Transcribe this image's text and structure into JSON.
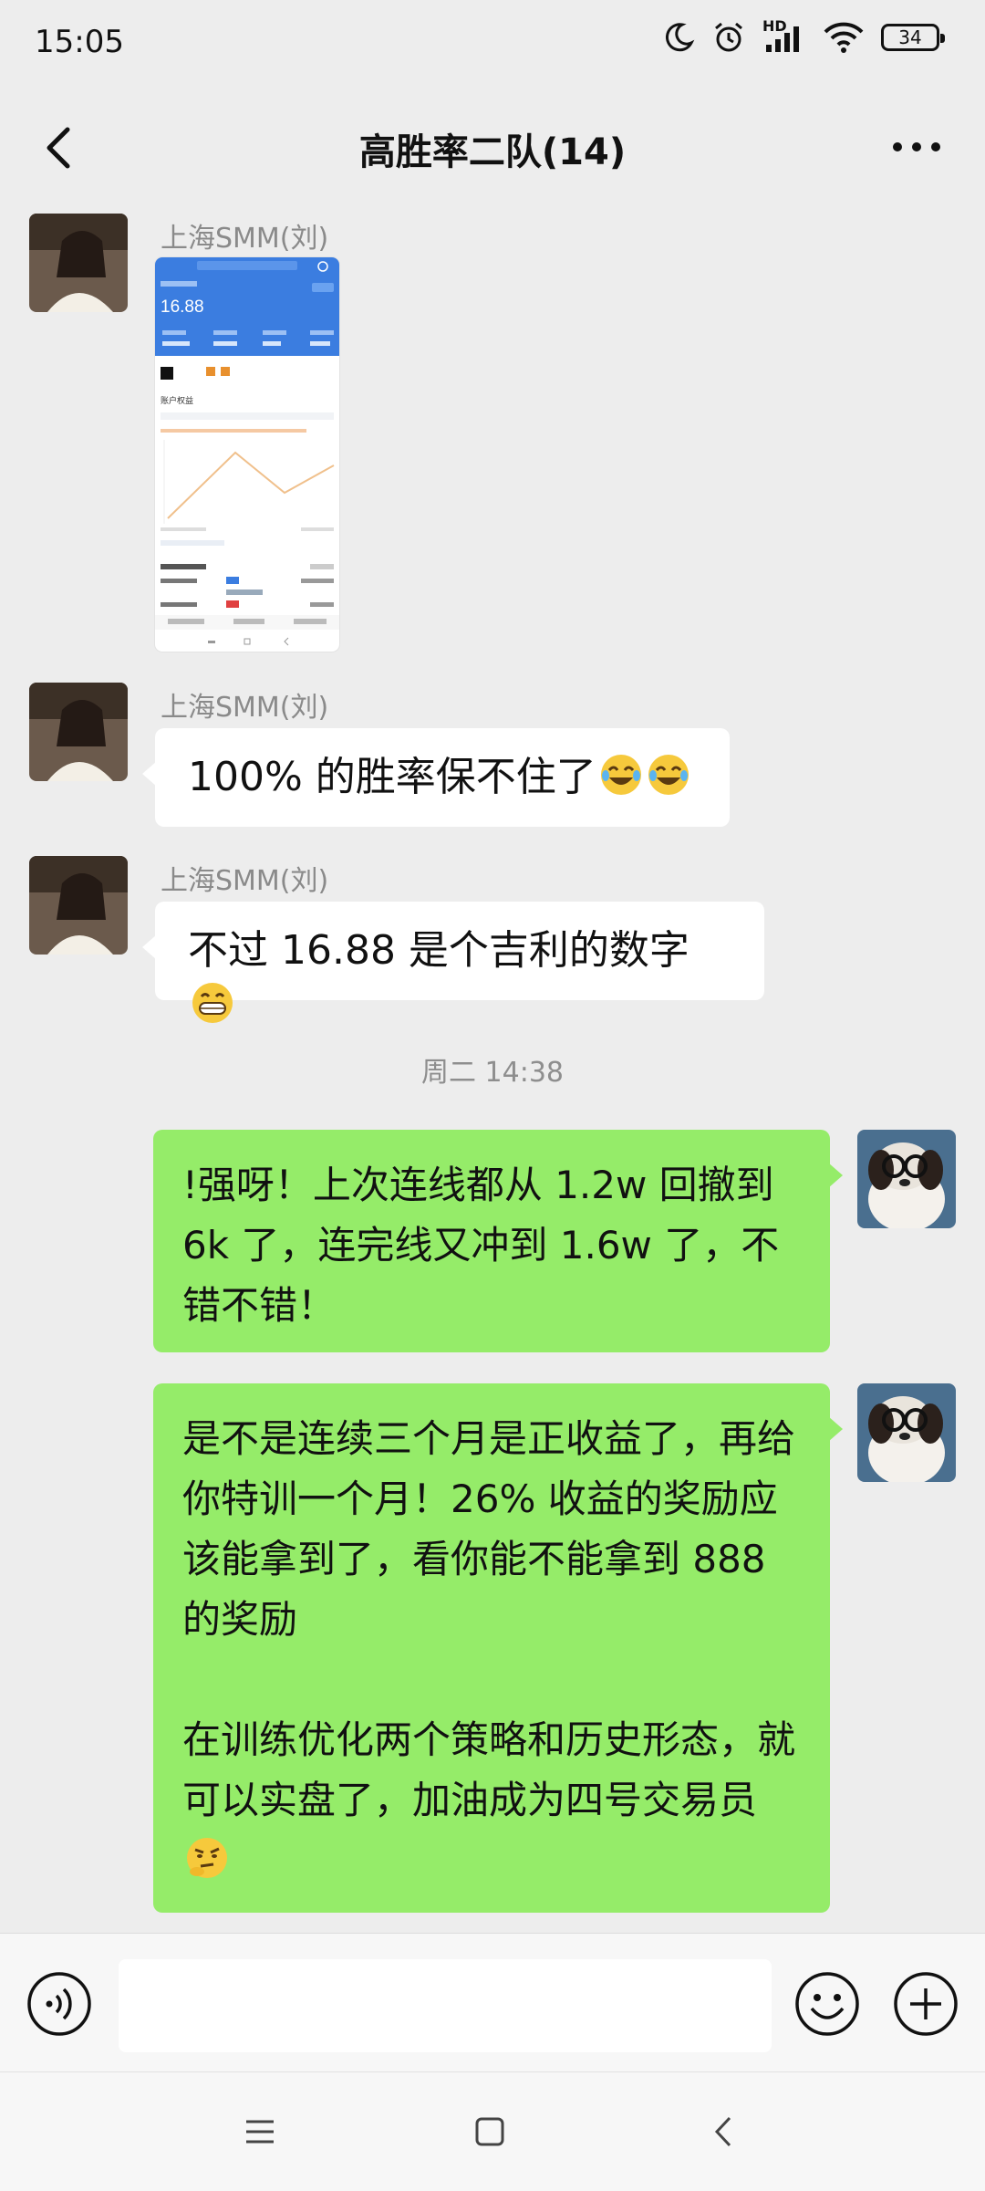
{
  "status": {
    "time": "15:05",
    "network": "HD",
    "battery": "34"
  },
  "header": {
    "title": "高胜率二队(14)"
  },
  "messages": [
    {
      "sender": "上海SMM(刘)"
    },
    {
      "sender": "上海SMM(刘)",
      "text": "100% 的胜率保不住了"
    },
    {
      "sender": "上海SMM(刘)",
      "text": "不过 16.88 是个吉利的数字"
    }
  ],
  "timestamp": "周二 14:38",
  "my_messages": [
    {
      "text": "!强呀！上次连线都从 1.2w 回撤到 6k 了，连完线又冲到 1.6w 了，不错不错！"
    },
    {
      "text": "是不是连续三个月是正收益了，再给你特训一个月！26% 收益的奖励应该能拿到了，看你能不能拿到 888 的奖励\n\n在训练优化两个策略和历史形态，就可以实盘了，加油成为四号交易员"
    }
  ],
  "screenshot_card": {
    "value": "16.88",
    "heading": "账户权益"
  },
  "input": {
    "placeholder": ""
  }
}
